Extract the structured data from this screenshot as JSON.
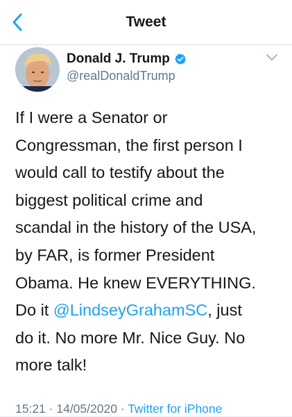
{
  "header": {
    "title": "Tweet",
    "back_icon": "chevron-left-icon"
  },
  "author": {
    "name": "Donald J. Trump",
    "handle": "@realDonaldTrump",
    "verified": true,
    "verified_icon": "verified-badge-icon",
    "more_icon": "chevron-down-icon"
  },
  "tweet": {
    "lines": [
      "If I were a Senator or",
      "Congressman, the first person I",
      "would call to testify about the",
      "biggest political crime and",
      "scandal in the history of the USA,",
      "by FAR, is former President",
      "Obama. He knew EVERYTHING."
    ],
    "line8_before": "Do it ",
    "mention": "@LindseyGrahamSC",
    "line8_after": ", just",
    "line9": "do it. No more Mr. Nice Guy. No",
    "line10": "more talk!"
  },
  "meta": {
    "time": "15:21",
    "date": "14/05/2020",
    "separator": " · ",
    "source": "Twitter for iPhone"
  },
  "colors": {
    "accent": "#1da1f2",
    "secondary_text": "#657786",
    "primary_text": "#14171a"
  }
}
